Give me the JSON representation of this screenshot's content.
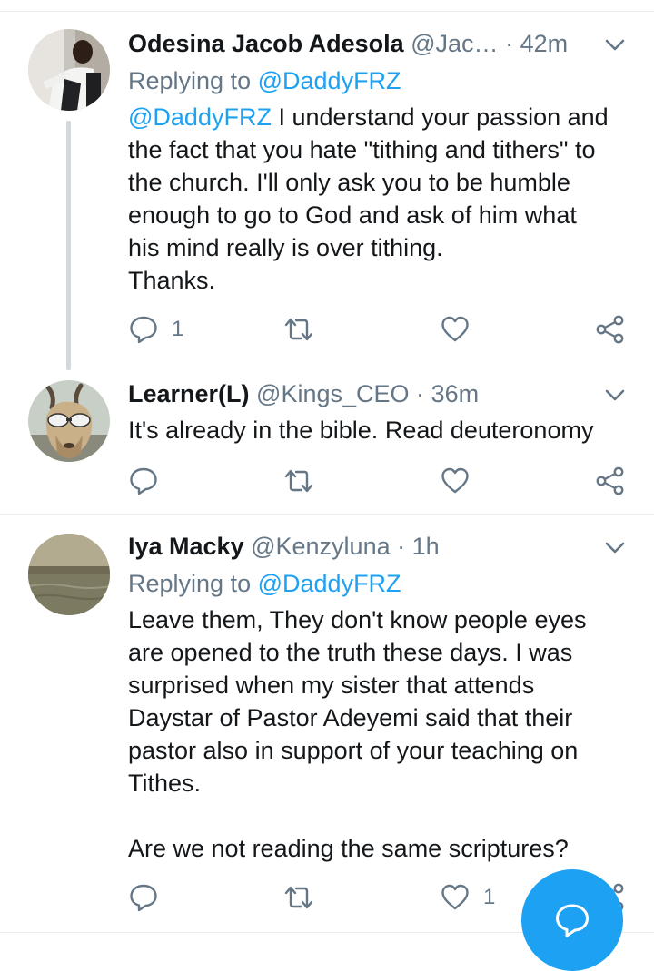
{
  "tweets": [
    {
      "name": "Odesina Jacob Adesola",
      "handle": "@Jac…",
      "separator": "·",
      "time": "42m",
      "replying_prefix": "Replying to",
      "replying_to": "@DaddyFRZ",
      "text_mention": "@DaddyFRZ",
      "text_lines": [
        " I understand your passion and",
        "the fact that you hate \"tithing and tithers\" to",
        "the church. I'll only ask you to be humble",
        "enough to go to God and ask of him what",
        "his mind really is over tithing.",
        "Thanks."
      ],
      "reply_count": "1",
      "retweet_count": "",
      "like_count": ""
    },
    {
      "name": "Learner(L)",
      "handle": "@Kings_CEO",
      "separator": "·",
      "time": "36m",
      "text_lines": [
        "It's already in the bible. Read deuteronomy"
      ],
      "reply_count": "",
      "retweet_count": "",
      "like_count": ""
    },
    {
      "name": "Iya Macky",
      "handle": "@Kenzyluna",
      "separator": "·",
      "time": "1h",
      "replying_prefix": "Replying to",
      "replying_to": "@DaddyFRZ",
      "text_lines": [
        "Leave them, They don't know people eyes",
        "are opened to the truth these days. I was",
        "surprised when my sister that attends",
        "Daystar of Pastor Adeyemi said that their",
        "pastor also in support of your teaching on",
        "Tithes.",
        "",
        "Are we not reading the same scriptures?"
      ],
      "reply_count": "",
      "retweet_count": "",
      "like_count": "1"
    }
  ],
  "icons": {
    "reply": "speech-bubble-icon",
    "retweet": "retweet-icon",
    "like": "heart-icon",
    "share": "share-icon",
    "menu": "chevron-down-icon",
    "compose": "compose-reply-icon"
  },
  "colors": {
    "accent": "#1da1f2",
    "secondary_text": "#657786",
    "primary_text": "#14171a",
    "divider": "#e6ecf0",
    "thread_line": "#cfd9de"
  }
}
